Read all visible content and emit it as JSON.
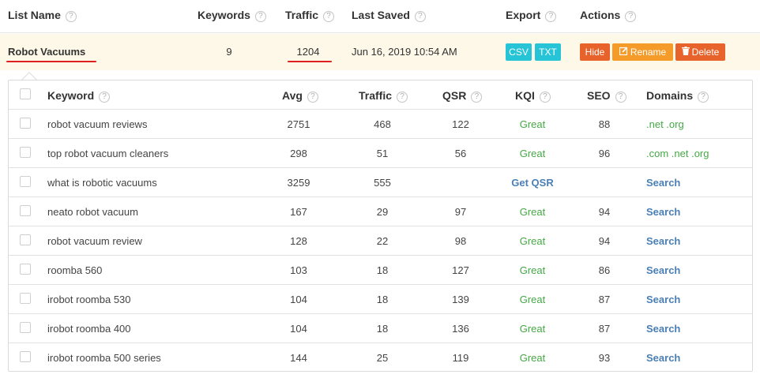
{
  "top_headers": {
    "list_name": "List Name",
    "keywords": "Keywords",
    "traffic": "Traffic",
    "last_saved": "Last Saved",
    "export": "Export",
    "actions": "Actions",
    "help_glyph": "?"
  },
  "list": {
    "name": "Robot Vacuums",
    "keywords": "9",
    "traffic": "1204",
    "last_saved": "Jun 16, 2019 10:54 AM",
    "export_csv": "CSV",
    "export_txt": "TXT",
    "hide": "Hide",
    "rename": "Rename",
    "delete": "Delete",
    "underline_color": "#e02020"
  },
  "table": {
    "headers": {
      "keyword": "Keyword",
      "avg": "Avg",
      "traffic": "Traffic",
      "qsr": "QSR",
      "kqi": "KQI",
      "seo": "SEO",
      "domains": "Domains"
    },
    "rows": [
      {
        "keyword": "robot vacuum reviews",
        "avg": "2751",
        "traffic": "468",
        "qsr": "122",
        "kqi": "Great",
        "seo": "88",
        "domains": ".net .org"
      },
      {
        "keyword": "top robot vacuum cleaners",
        "avg": "298",
        "traffic": "51",
        "qsr": "56",
        "kqi": "Great",
        "seo": "96",
        "domains": ".com .net .org"
      },
      {
        "keyword": "what is robotic vacuums",
        "avg": "3259",
        "traffic": "555",
        "qsr": "",
        "kqi": "Get QSR",
        "seo": "",
        "domains": "Search"
      },
      {
        "keyword": "neato robot vacuum",
        "avg": "167",
        "traffic": "29",
        "qsr": "97",
        "kqi": "Great",
        "seo": "94",
        "domains": "Search"
      },
      {
        "keyword": "robot vacuum review",
        "avg": "128",
        "traffic": "22",
        "qsr": "98",
        "kqi": "Great",
        "seo": "94",
        "domains": "Search"
      },
      {
        "keyword": "roomba 560",
        "avg": "103",
        "traffic": "18",
        "qsr": "127",
        "kqi": "Great",
        "seo": "86",
        "domains": "Search"
      },
      {
        "keyword": "irobot roomba 530",
        "avg": "104",
        "traffic": "18",
        "qsr": "139",
        "kqi": "Great",
        "seo": "87",
        "domains": "Search"
      },
      {
        "keyword": "irobot roomba 400",
        "avg": "104",
        "traffic": "18",
        "qsr": "136",
        "kqi": "Great",
        "seo": "87",
        "domains": "Search"
      },
      {
        "keyword": "irobot roomba 500 series",
        "avg": "144",
        "traffic": "25",
        "qsr": "119",
        "kqi": "Great",
        "seo": "93",
        "domains": "Search"
      }
    ]
  },
  "colors": {
    "export_button": "#27c3d6",
    "hide_button": "#e8622b",
    "rename_button": "#f49b2a",
    "delete_button": "#e8622b",
    "great_text": "#45a845",
    "link_text": "#4a7fb5",
    "list_row_bg": "#fdf8e7"
  },
  "icons": {
    "rename": "edit-icon",
    "delete": "trash-icon",
    "help": "question-circle-icon"
  }
}
